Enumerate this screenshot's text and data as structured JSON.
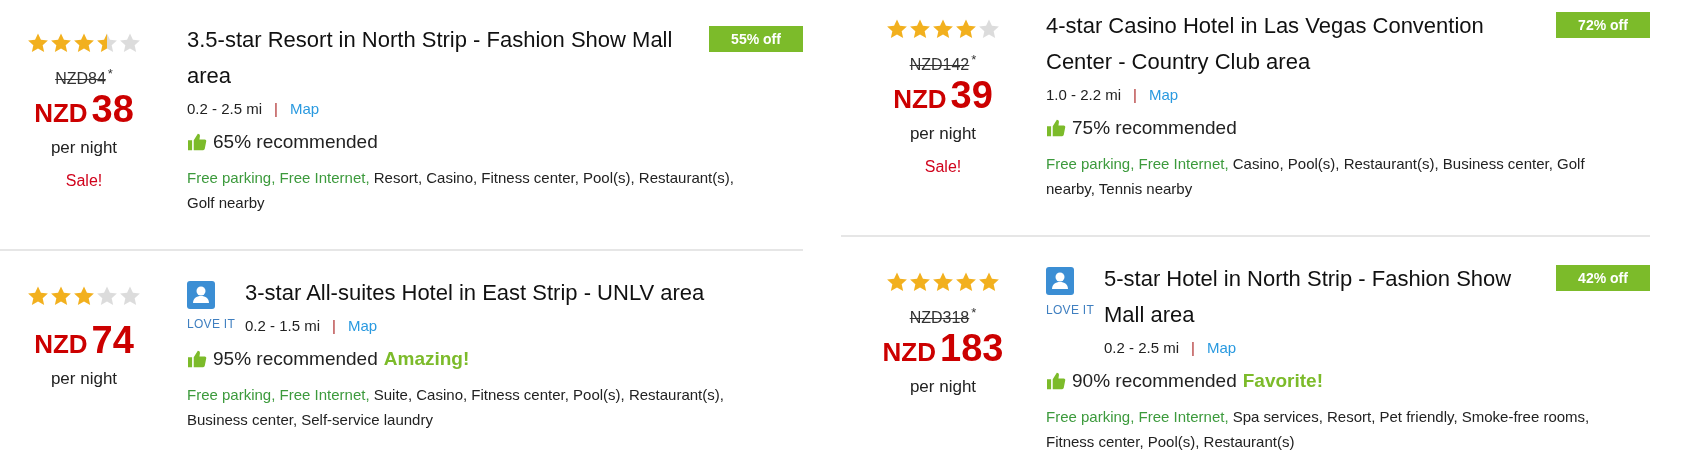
{
  "columns": [
    {
      "hotels": [
        {
          "stars": 3.5,
          "original_price": "NZD84",
          "original_price_mark": "*",
          "currency": "NZD",
          "amount": "38",
          "per_night": "per night",
          "sale": "Sale!",
          "title": "3.5-star Resort in North Strip - Fashion Show Mall area",
          "distance": "0.2 - 2.5 mi",
          "separator": "|",
          "map": "Map",
          "recommended": "65% recommended",
          "amenities_free": "Free parking, Free Internet,",
          "amenities": "Resort, Casino, Fitness center, Pool(s), Restaurant(s), Golf nearby",
          "discount": "55% off"
        },
        {
          "stars": 3,
          "currency": "NZD",
          "amount": "74",
          "per_night": "per night",
          "love_it": "LOVE IT",
          "title": "3-star All-suites Hotel in East Strip - UNLV area",
          "distance": "0.2 - 1.5 mi",
          "separator": "|",
          "map": "Map",
          "recommended": "95% recommended",
          "recommend_tag": "Amazing!",
          "amenities_free": "Free parking, Free Internet,",
          "amenities": "Suite, Casino, Fitness center, Pool(s), Restaurant(s), Business center, Self-service laundry"
        }
      ]
    },
    {
      "hotels": [
        {
          "stars": 4,
          "original_price": "NZD142",
          "original_price_mark": "*",
          "currency": "NZD",
          "amount": "39",
          "per_night": "per night",
          "sale": "Sale!",
          "title": "4-star Casino Hotel in Las Vegas Convention Center - Country Club area",
          "distance": "1.0 - 2.2 mi",
          "separator": "|",
          "map": "Map",
          "recommended": "75% recommended",
          "amenities_free": "Free parking, Free Internet,",
          "amenities": "Casino, Pool(s), Restaurant(s), Business center, Golf nearby, Tennis nearby",
          "discount": "72% off"
        },
        {
          "stars": 5,
          "original_price": "NZD318",
          "original_price_mark": "*",
          "currency": "NZD",
          "amount": "183",
          "per_night": "per night",
          "love_it": "LOVE IT",
          "title": "5-star Hotel in North Strip - Fashion Show Mall area",
          "distance": "0.2 - 2.5 mi",
          "separator": "|",
          "map": "Map",
          "recommended": "90% recommended",
          "recommend_tag": "Favorite!",
          "amenities_free": "Free parking, Free Internet,",
          "amenities": "Spa services, Resort, Pet friendly, Smoke-free rooms, Fitness center, Pool(s), Restaurant(s)",
          "discount": "42% off"
        }
      ]
    }
  ]
}
